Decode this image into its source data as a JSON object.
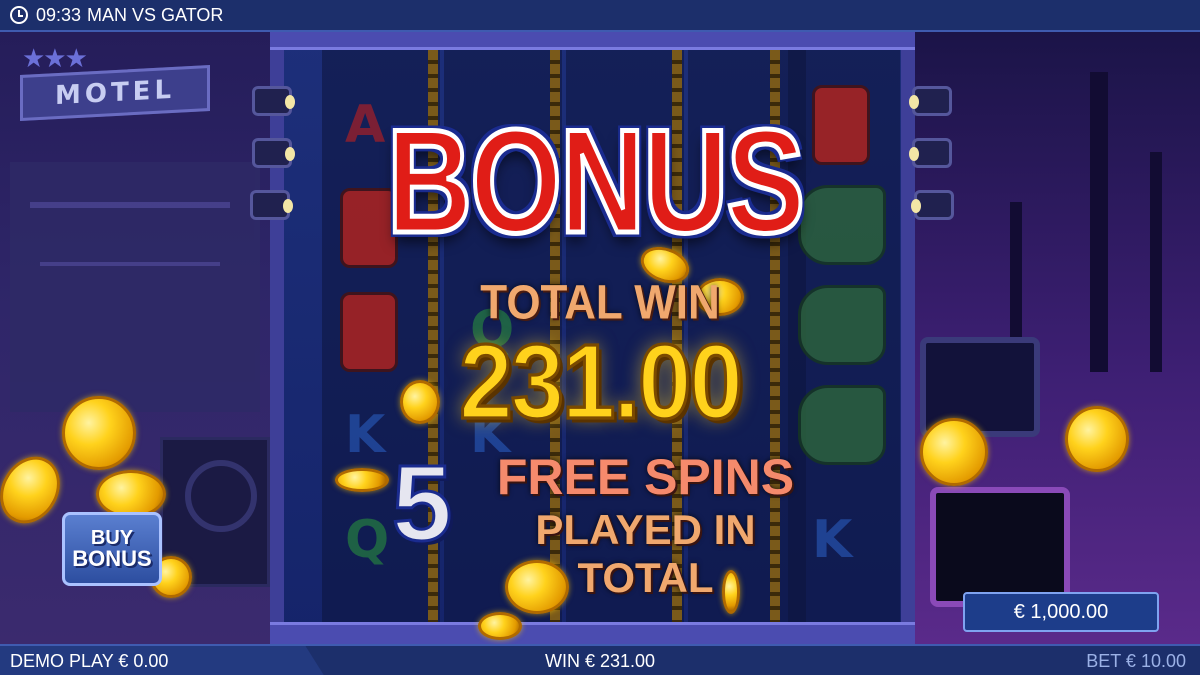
{
  "topbar": {
    "time": "09:33",
    "title": "MAN VS GATOR"
  },
  "scene": {
    "motel_sign": "MOTEL"
  },
  "reels": {
    "symbols": [
      "A",
      "K",
      "Q",
      "K",
      "Q",
      "K"
    ]
  },
  "overlay": {
    "heading": "BONUS",
    "total_win_label": "TOTAL WIN",
    "total_win_amount": "231.00",
    "spins_count": "5",
    "spins_line1": "FREE SPINS",
    "spins_line2": "PLAYED IN TOTAL"
  },
  "buy_bonus": {
    "line1": "BUY",
    "line2": "BONUS"
  },
  "balance": {
    "value": "€ 1,000.00"
  },
  "bottombar": {
    "demo_play": "DEMO PLAY € 0.00",
    "win": "WIN € 231.00",
    "bet": "BET € 10.00"
  },
  "colors": {
    "bonus_red": "#e01d17",
    "gold": "#ffd21c",
    "bar_blue": "#1c2f6b",
    "spins_text": "#f58a6c"
  },
  "icons": [
    "clock-icon",
    "star-icon",
    "coin-icon",
    "spotlight-icon",
    "gas-can-icon",
    "gator-icon"
  ]
}
